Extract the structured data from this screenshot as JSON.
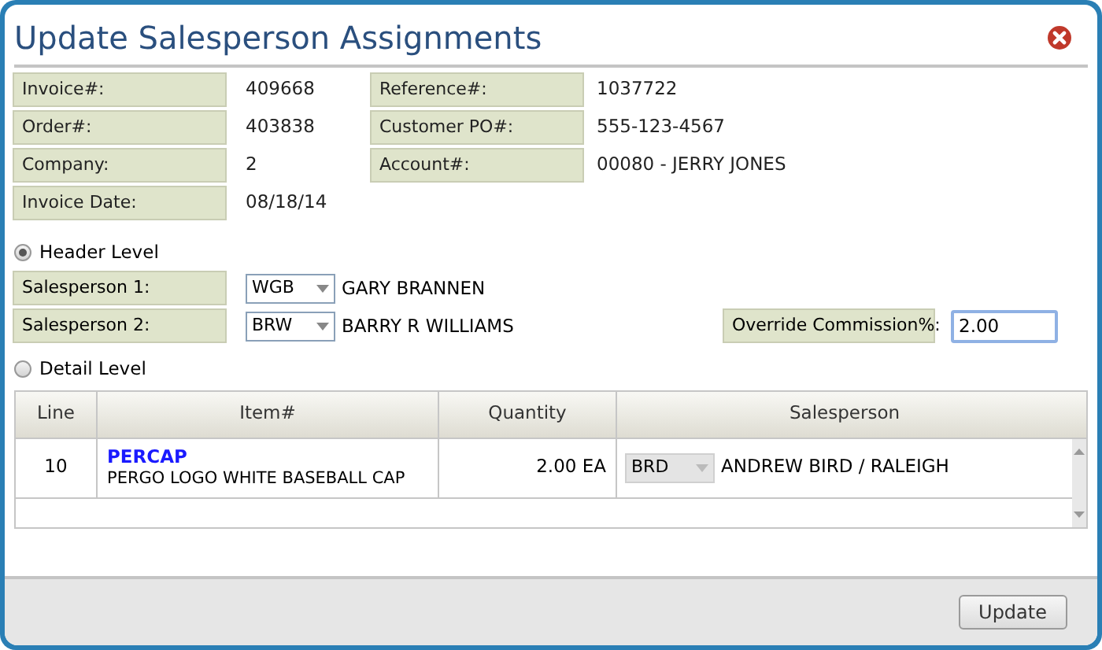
{
  "window": {
    "title": "Update Salesperson Assignments"
  },
  "info_left": [
    {
      "label": "Invoice#:",
      "value": "409668"
    },
    {
      "label": "Order#:",
      "value": "403838"
    },
    {
      "label": "Company:",
      "value": "2"
    },
    {
      "label": "Invoice Date:",
      "value": "08/18/14"
    }
  ],
  "info_right": [
    {
      "label": "Reference#:",
      "value": "1037722"
    },
    {
      "label": "Customer PO#:",
      "value": "555-123-4567"
    },
    {
      "label": "Account#:",
      "value": "00080 - JERRY JONES"
    }
  ],
  "levels": [
    {
      "label": "Header Level",
      "selected": true
    },
    {
      "label": "Detail Level",
      "selected": false
    }
  ],
  "salespersons": [
    {
      "label": "Salesperson 1:",
      "code": "WGB",
      "name": "GARY BRANNEN"
    },
    {
      "label": "Salesperson 2:",
      "code": "BRW",
      "name": "BARRY R WILLIAMS"
    }
  ],
  "override": {
    "label": "Override Commission%:",
    "value": "2.00"
  },
  "table": {
    "columns": [
      "Line",
      "Item#",
      "Quantity",
      "Salesperson"
    ],
    "rows": [
      {
        "line": "10",
        "item": "PERCAP",
        "description": "PERGO LOGO WHITE BASEBALL CAP",
        "quantity": "2.00 EA",
        "code": "BRD",
        "disabled": true,
        "salesperson": "ANDREW BIRD / RALEIGH"
      }
    ]
  },
  "buttons": [
    "Update"
  ]
}
